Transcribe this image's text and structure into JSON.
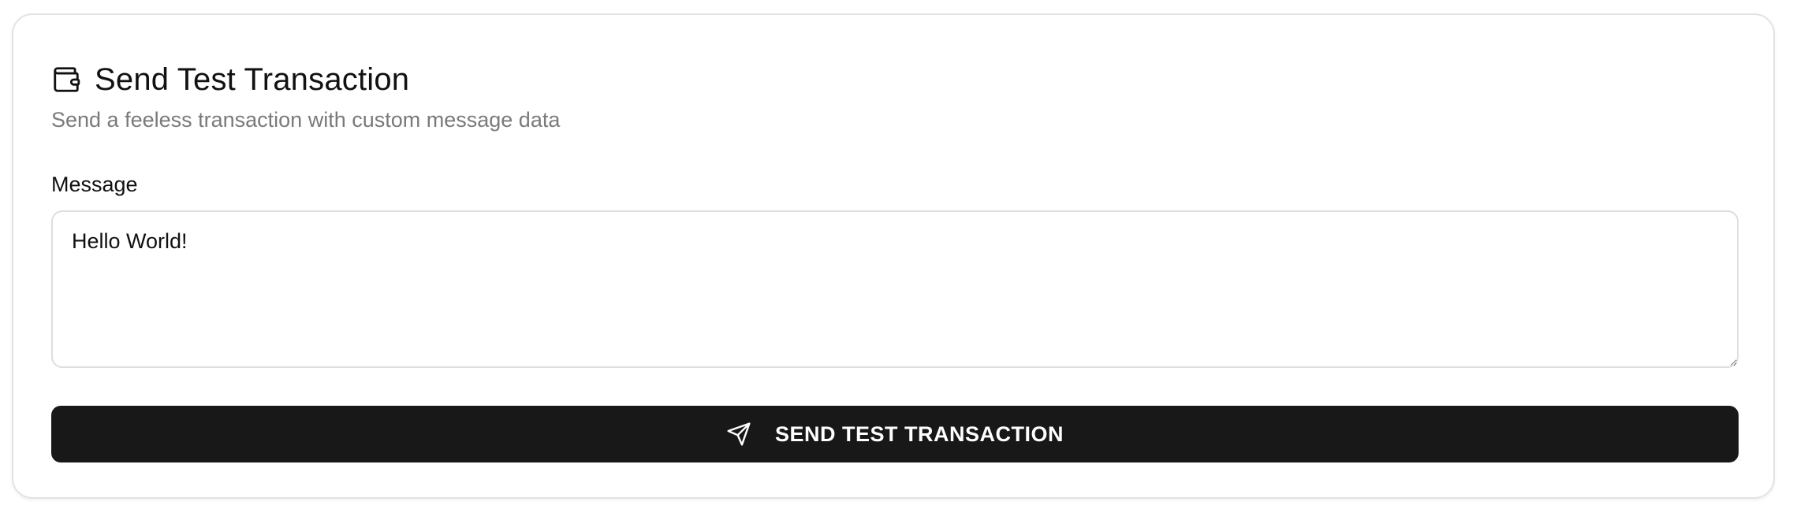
{
  "card": {
    "title": "Send Test Transaction",
    "title_icon": "wallet-icon",
    "subtitle": "Send a feeless transaction with custom message data"
  },
  "message": {
    "label": "Message",
    "value": "Hello World!"
  },
  "send_button": {
    "label": "SEND TEST TRANSACTION",
    "icon": "send-icon"
  },
  "colors": {
    "button_bg": "#181818",
    "subtitle": "#7a7a7a",
    "border": "#e3e3e3"
  }
}
